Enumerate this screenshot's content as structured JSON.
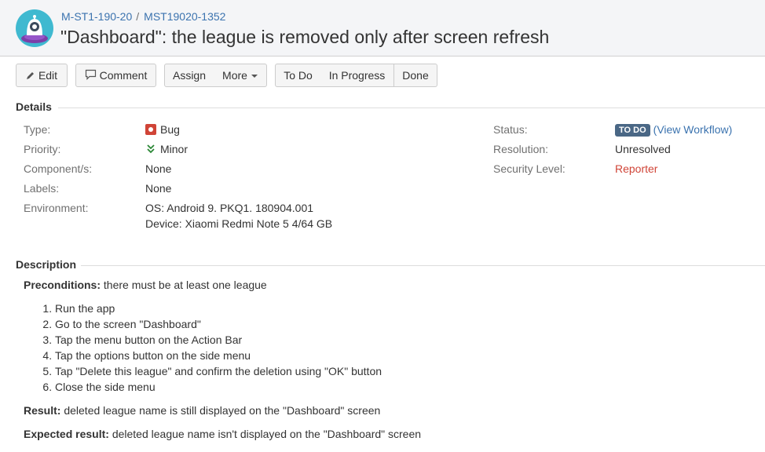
{
  "header": {
    "breadcrumb": [
      "M-ST1-190-20",
      "MST19020-1352"
    ],
    "breadcrumb_separator": "/",
    "title": "\"Dashboard\": the league is removed only after screen refresh",
    "avatar_icon": "project-avatar-icon"
  },
  "toolbar": {
    "edit": "Edit",
    "comment": "Comment",
    "assign": "Assign",
    "more": "More",
    "todo": "To Do",
    "in_progress": "In Progress",
    "done": "Done"
  },
  "details": {
    "title": "Details",
    "type_label": "Type:",
    "type_value": "Bug",
    "priority_label": "Priority:",
    "priority_value": "Minor",
    "component_label": "Component/s:",
    "component_value": "None",
    "labels_label": "Labels:",
    "labels_value": "None",
    "environment_label": "Environment:",
    "environment_line1": "OS: Android 9. PKQ1. 180904.001",
    "environment_line2": "Device: Xiaomi Redmi Note 5 4/64 GB",
    "status_label": "Status:",
    "status_value": "TO DO",
    "view_workflow_open": "(",
    "view_workflow": "View Workflow",
    "view_workflow_close": ")",
    "resolution_label": "Resolution:",
    "resolution_value": "Unresolved",
    "security_label": "Security Level:",
    "security_value": "Reporter"
  },
  "description": {
    "title": "Description",
    "preconditions_label": "Preconditions:",
    "preconditions_text": " there must be at least one league",
    "steps": [
      "Run the app",
      "Go to the screen \"Dashboard\"",
      "Tap the menu button on the Action Bar",
      "Tap the options button on the side menu",
      "Tap \"Delete this league\" and confirm the deletion using \"OK\" button",
      "Close the side menu"
    ],
    "result_label": "Result:",
    "result_text": " deleted league name is still displayed on the \"Dashboard\" screen",
    "expected_label": "Expected result:",
    "expected_text": " deleted league name isn't displayed on the \"Dashboard\" screen"
  },
  "colors": {
    "link": "#3b73af",
    "lozenge": "#4a6785",
    "reporter": "#d04437",
    "bug": "#d04437",
    "minor": "#2a8735"
  }
}
